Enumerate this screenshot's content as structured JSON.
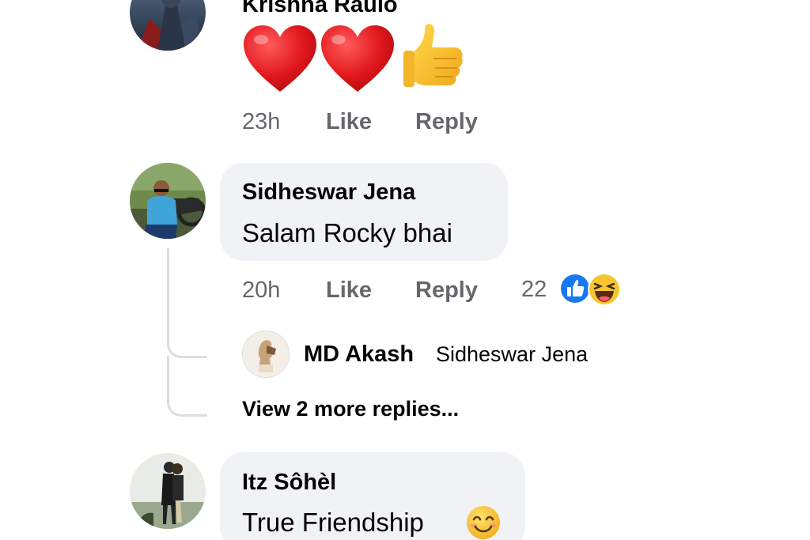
{
  "comments": [
    {
      "author": "Krishna Raulo",
      "emoji_body": [
        "heart-emoji",
        "heart-emoji",
        "thumbs-up-emoji"
      ],
      "time": "23h",
      "like": "Like",
      "reply": "Reply"
    },
    {
      "author": "Sidheswar Jena",
      "text": "Salam Rocky bhai",
      "time": "20h",
      "like": "Like",
      "reply": "Reply",
      "reaction_count": "22",
      "reaction_icons": [
        "like-reaction-icon",
        "haha-reaction-icon"
      ]
    },
    {
      "author": "Itz Sôhèl",
      "text": "True Friendship",
      "trailing_emoji": "smiling-face-emoji"
    }
  ],
  "reply_preview": {
    "author": "MD Akash",
    "mention": "Sidheswar Jena"
  },
  "view_more": "View 2 more replies...",
  "colors": {
    "bubble": "#f0f2f5",
    "meta_text": "#65676b",
    "text": "#050505",
    "like_blue": "#1877f2",
    "thread_line": "#dadde1"
  }
}
